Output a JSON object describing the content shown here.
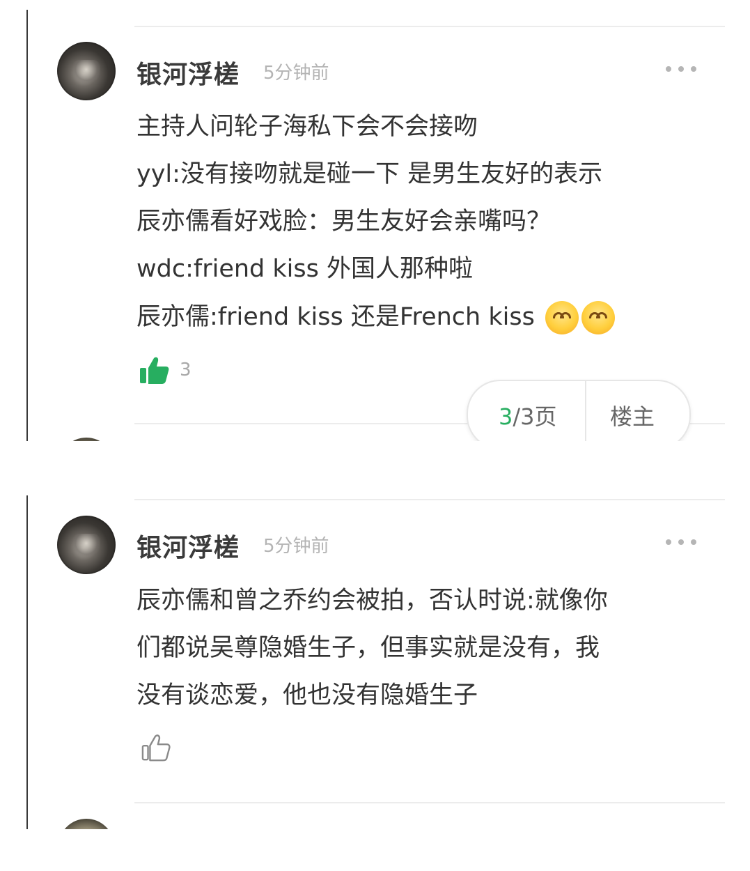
{
  "posts": [
    {
      "username": "银河浮槎",
      "time": "5分钟前",
      "lines": [
        "主持人问轮子海私下会不会接吻",
        "yyl:没有接吻就是碰一下 是男生友好的表示",
        "辰亦儒看好戏脸：男生友好会亲嘴吗？",
        "wdc:friend kiss 外国人那种啦",
        "辰亦儒:friend kiss 还是French kiss"
      ],
      "emojis": [
        "hug-emoji",
        "hug-emoji"
      ],
      "like_icon": "thumbs-up-filled-icon",
      "like_count": "3",
      "pager": {
        "current": "3",
        "total_suffix": "/3页",
        "owner_label": "楼主"
      }
    },
    {
      "username": "银河浮槎",
      "time": "5分钟前",
      "lines": [
        "辰亦儒和曾之乔约会被拍，否认时说:就像你",
        "们都说吴尊隐婚生子，但事实就是没有，我",
        "没有谈恋爱，他也没有隐婚生子"
      ],
      "like_icon": "thumbs-up-outline-icon"
    }
  ],
  "colors": {
    "accent_green": "#27ae60",
    "username": "#3a3a3a",
    "muted": "#b4b4b4"
  }
}
